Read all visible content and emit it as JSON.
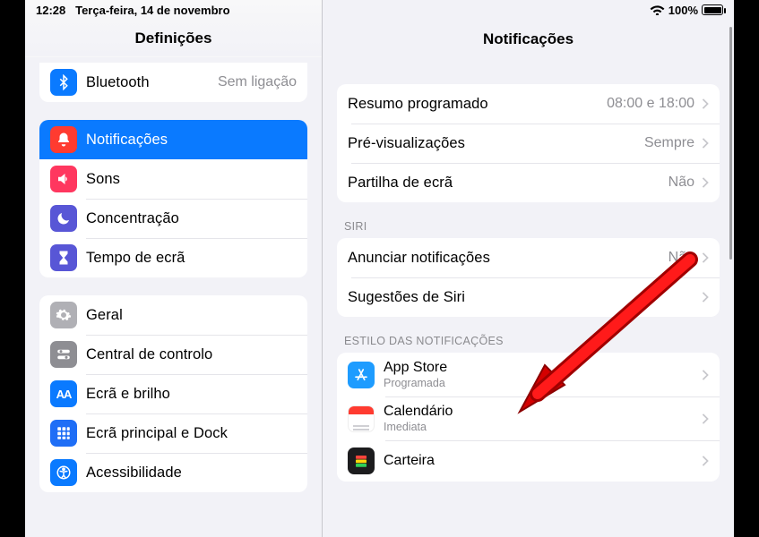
{
  "statusbar": {
    "time": "12:28",
    "date": "Terça-feira, 14 de novembro",
    "battery_pct": "100%"
  },
  "sidebar": {
    "title": "Definições",
    "items": [
      {
        "id": "bluetooth",
        "label": "Bluetooth",
        "value": "Sem ligação",
        "icon": "bluetooth",
        "bg": "bg-blue"
      },
      {
        "id": "notifications",
        "label": "Notificações",
        "icon": "bell",
        "bg": "bg-red",
        "selected": true
      },
      {
        "id": "sounds",
        "label": "Sons",
        "icon": "speaker",
        "bg": "bg-redpink"
      },
      {
        "id": "focus",
        "label": "Concentração",
        "icon": "moon",
        "bg": "bg-indigo"
      },
      {
        "id": "screentime",
        "label": "Tempo de ecrã",
        "icon": "hourglass",
        "bg": "bg-indigo"
      },
      {
        "id": "general",
        "label": "Geral",
        "icon": "gear",
        "bg": "bg-graylight"
      },
      {
        "id": "controlcenter",
        "label": "Central de controlo",
        "icon": "switches",
        "bg": "bg-gray"
      },
      {
        "id": "display",
        "label": "Ecrã e brilho",
        "icon": "aa",
        "bg": "bg-blue"
      },
      {
        "id": "homescreen",
        "label": "Ecrã principal e Dock",
        "icon": "grid",
        "bg": "bg-darkblue"
      },
      {
        "id": "accessibility",
        "label": "Acessibilidade",
        "icon": "person",
        "bg": "bg-blue"
      }
    ]
  },
  "detail": {
    "title": "Notificações",
    "group1": [
      {
        "id": "summary",
        "label": "Resumo programado",
        "value": "08:00 e 18:00"
      },
      {
        "id": "previews",
        "label": "Pré-visualizações",
        "value": "Sempre"
      },
      {
        "id": "screenshare",
        "label": "Partilha de ecrã",
        "value": "Não"
      }
    ],
    "siri_header": "SIRI",
    "group2": [
      {
        "id": "announce",
        "label": "Anunciar notificações",
        "value": "Não"
      },
      {
        "id": "siri-suggest",
        "label": "Sugestões de Siri",
        "value": ""
      }
    ],
    "style_header": "ESTILO DAS NOTIFICAÇÕES",
    "apps": [
      {
        "id": "appstore",
        "title": "App Store",
        "sub": "Programada",
        "icon": "appstore",
        "bg": "bg-appstore"
      },
      {
        "id": "calendar",
        "title": "Calendário",
        "sub": "Imediata",
        "icon": "calendar",
        "bg": ""
      },
      {
        "id": "wallet",
        "title": "Carteira",
        "sub": "",
        "icon": "wallet",
        "bg": "bg-wallet"
      }
    ]
  }
}
